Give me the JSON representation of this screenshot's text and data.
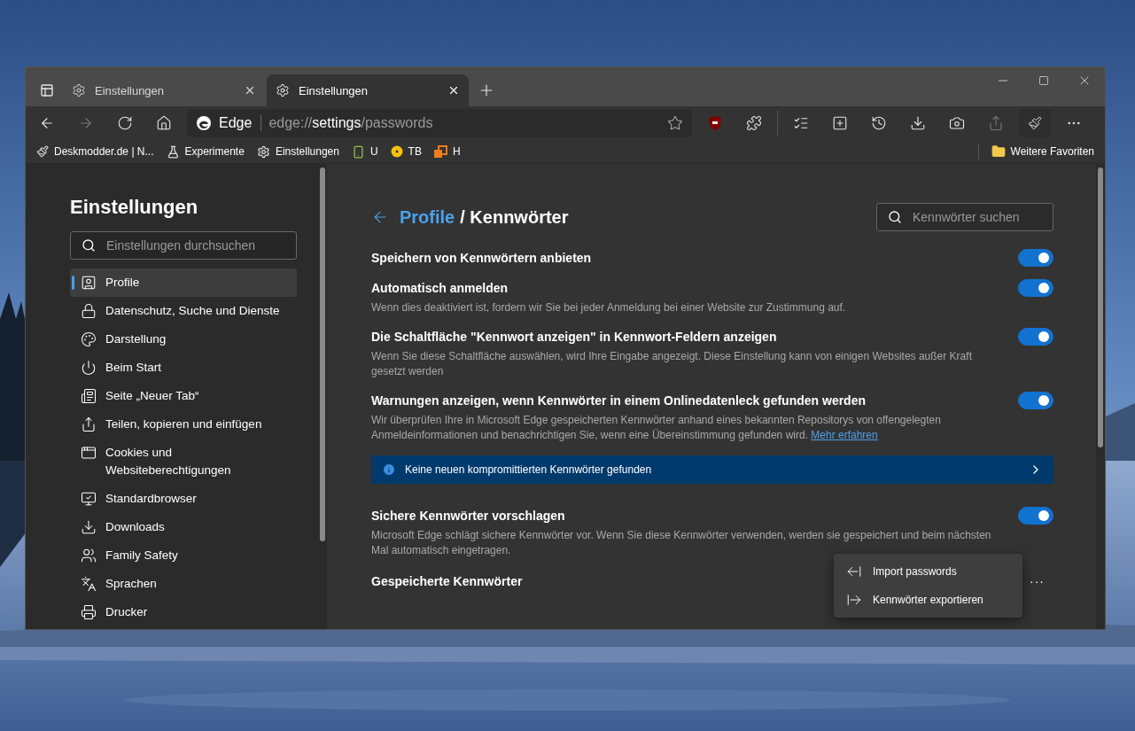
{
  "window": {
    "tabs": [
      {
        "label": "Einstellungen",
        "selected": false
      },
      {
        "label": "Einstellungen",
        "selected": true
      }
    ]
  },
  "address_bar": {
    "brand": "Edge",
    "url_scheme": "edge://",
    "url_host": "settings",
    "url_path": "/passwords"
  },
  "bookmarks": [
    {
      "label": "Deskmodder.de | N...",
      "kind": "brush"
    },
    {
      "label": "Experimente",
      "kind": "flask"
    },
    {
      "label": "Einstellungen",
      "kind": "gear"
    },
    {
      "label": "U",
      "kind": "phone"
    },
    {
      "label": "TB",
      "kind": "disc"
    },
    {
      "label": "H",
      "kind": "squares"
    }
  ],
  "other_favorites": "Weitere Favoriten",
  "sidebar": {
    "title": "Einstellungen",
    "search_placeholder": "Einstellungen durchsuchen",
    "items": [
      {
        "label": "Profile",
        "kind": "profile",
        "selected": true
      },
      {
        "label": "Datenschutz, Suche und Dienste",
        "kind": "lock",
        "selected": false
      },
      {
        "label": "Darstellung",
        "kind": "palette",
        "selected": false
      },
      {
        "label": "Beim Start",
        "kind": "power",
        "selected": false
      },
      {
        "label": "Seite „Neuer Tab“",
        "kind": "newtab",
        "selected": false
      },
      {
        "label": "Teilen, kopieren und einfügen",
        "kind": "share",
        "selected": false
      },
      {
        "label": "Cookies und Websiteberechtigungen",
        "kind": "cookies",
        "selected": false
      },
      {
        "label": "Standardbrowser",
        "kind": "browser",
        "selected": false
      },
      {
        "label": "Downloads",
        "kind": "download",
        "selected": false
      },
      {
        "label": "Family Safety",
        "kind": "family",
        "selected": false
      },
      {
        "label": "Sprachen",
        "kind": "language",
        "selected": false
      },
      {
        "label": "Drucker",
        "kind": "printer",
        "selected": false
      }
    ]
  },
  "main": {
    "breadcrumb_parent": "Profile",
    "title": "/ Kennwörter",
    "search_placeholder": "Kennwörter suchen",
    "settings": [
      {
        "label": "Speichern von Kennwörtern anbieten",
        "on": true
      },
      {
        "label": "Automatisch anmelden",
        "on": true,
        "description": "Wenn dies deaktiviert ist, fordern wir Sie bei jeder Anmeldung bei einer Website zur Zustimmung auf."
      },
      {
        "label": "Die Schaltfläche \"Kennwort anzeigen\" in Kennwort-Feldern anzeigen",
        "on": true,
        "description": "Wenn Sie diese Schaltfläche auswählen, wird Ihre Eingabe angezeigt. Diese Einstellung kann von einigen Websites außer Kraft gesetzt werden"
      },
      {
        "label": "Warnungen anzeigen, wenn Kennwörter in einem Onlinedatenleck gefunden werden",
        "on": true,
        "description": "Wir überprüfen Ihre in Microsoft Edge gespeicherten Kennwörter anhand eines bekannten Repositorys von offengelegten Anmeldeinformationen und benachrichtigen Sie, wenn eine Übereinstimmung gefunden wird.",
        "link": "Mehr erfahren",
        "banner": "Keine neuen kompromittierten Kennwörter gefunden"
      },
      {
        "label": "Sichere Kennwörter vorschlagen",
        "on": true,
        "description": "Microsoft Edge schlägt sichere Kennwörter vor. Wenn Sie diese Kennwörter verwenden, werden sie gespeichert und beim nächsten Mal automatisch eingetragen."
      }
    ],
    "saved_title": "Gespeicherte Kennwörter",
    "more_button": "···",
    "menu": [
      {
        "label": "Import passwords",
        "kind": "import"
      },
      {
        "label": "Kennwörter exportieren",
        "kind": "export"
      }
    ]
  }
}
